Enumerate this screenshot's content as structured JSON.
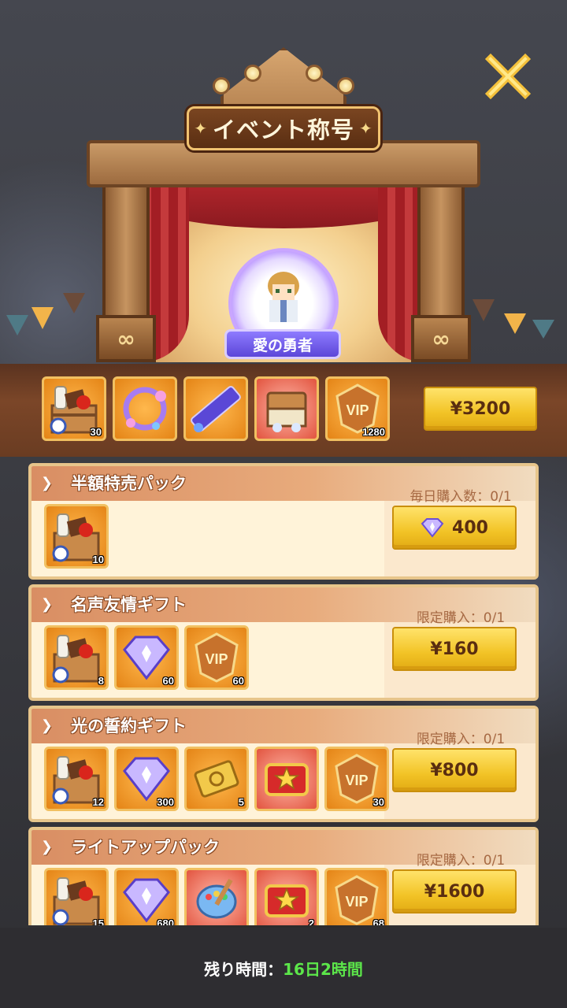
{
  "header": {
    "title": "イベント称号",
    "emblem_label": "愛の勇者"
  },
  "top_rewards": {
    "items": [
      {
        "icon": "food-crate-icon",
        "count": "30"
      },
      {
        "icon": "flower-frame-icon",
        "count": ""
      },
      {
        "icon": "title-banner-icon",
        "count": ""
      },
      {
        "icon": "treasure-chest-icon",
        "count": ""
      },
      {
        "icon": "vip-badge-icon",
        "count": "1280"
      }
    ],
    "price": "¥3200"
  },
  "packs": [
    {
      "title": "半額特売パック",
      "limit": "毎日購入数：0/1",
      "price": "400",
      "price_icon": "diamond-icon",
      "items": [
        {
          "icon": "food-crate-icon",
          "count": "10"
        }
      ]
    },
    {
      "title": "名声友情ギフト",
      "limit": "限定購入：0/1",
      "price": "¥160",
      "items": [
        {
          "icon": "food-crate-icon",
          "count": "8"
        },
        {
          "icon": "diamond-icon",
          "count": "60"
        },
        {
          "icon": "vip-badge-icon",
          "count": "60"
        }
      ]
    },
    {
      "title": "光の誓約ギフト",
      "limit": "限定購入：0/1",
      "price": "¥800",
      "items": [
        {
          "icon": "food-crate-icon",
          "count": "12"
        },
        {
          "icon": "diamond-icon",
          "count": "300"
        },
        {
          "icon": "golden-ticket-icon",
          "count": "5"
        },
        {
          "icon": "star-chest-icon",
          "count": ""
        },
        {
          "icon": "vip-badge-icon",
          "count": "30"
        }
      ]
    },
    {
      "title": "ライトアップパック",
      "limit": "限定購入：0/1",
      "price": "¥1600",
      "items": [
        {
          "icon": "food-crate-icon",
          "count": "15"
        },
        {
          "icon": "diamond-icon",
          "count": "680"
        },
        {
          "icon": "paint-palette-icon",
          "count": ""
        },
        {
          "icon": "star-chest-icon",
          "count": "2"
        },
        {
          "icon": "vip-badge-icon",
          "count": "68"
        }
      ]
    }
  ],
  "footer": {
    "label": "残り時間：",
    "time": "16日2時間"
  },
  "close_icon": "close-icon"
}
